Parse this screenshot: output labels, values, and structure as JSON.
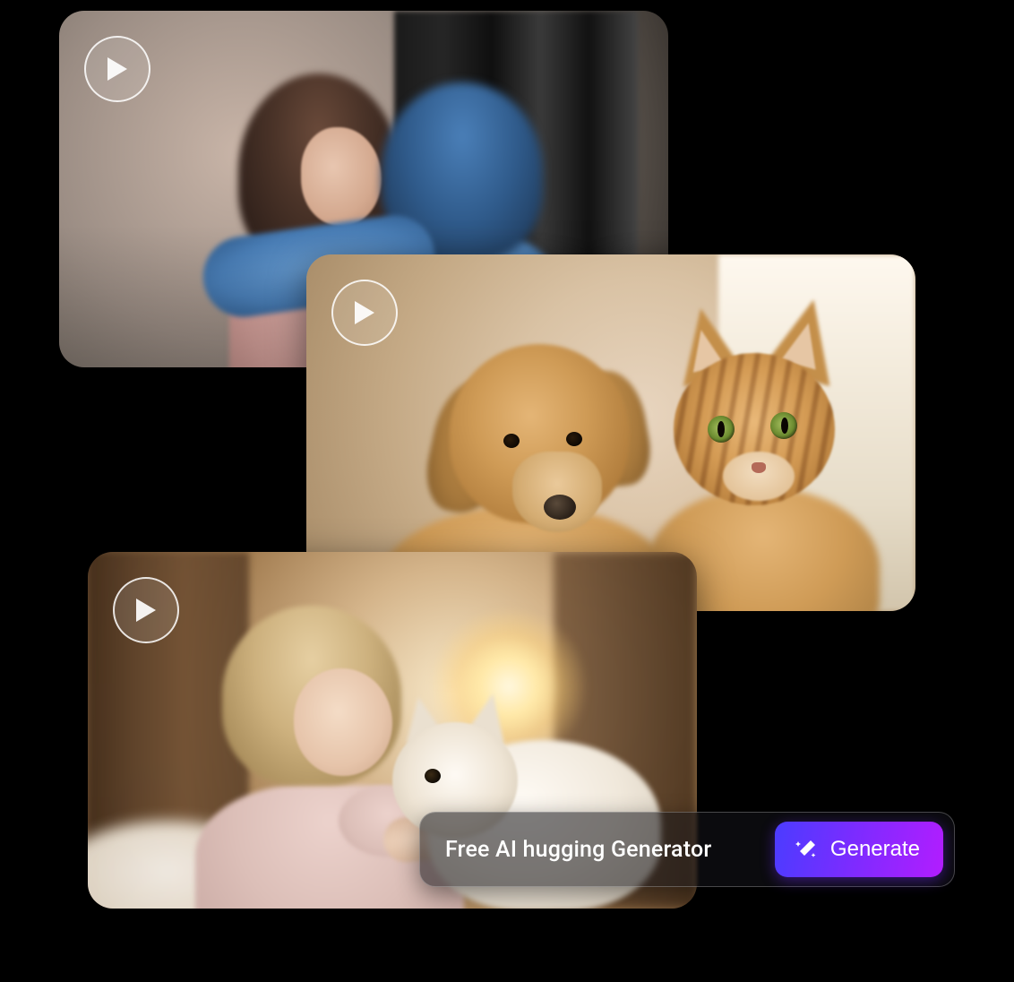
{
  "cards": [
    {
      "play_icon": "play-icon"
    },
    {
      "play_icon": "play-icon"
    },
    {
      "play_icon": "play-icon"
    }
  ],
  "overlay": {
    "label": "Free AI hugging Generator",
    "button_label": "Generate",
    "button_icon": "magic-wand-icon"
  },
  "colors": {
    "button_gradient_start": "#4b3cff",
    "button_gradient_mid": "#7a2cff",
    "button_gradient_end": "#b21dff"
  }
}
